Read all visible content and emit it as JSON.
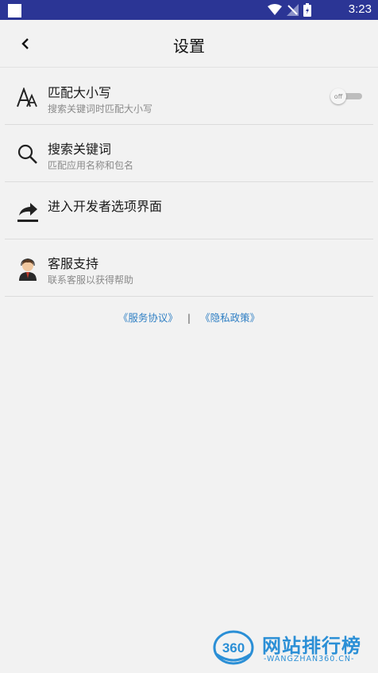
{
  "status_bar": {
    "time": "3:23",
    "icons": [
      "wifi-icon",
      "signal-off-icon",
      "battery-icon"
    ]
  },
  "header": {
    "title": "设置",
    "back_icon": "chevron-left-icon"
  },
  "settings": [
    {
      "title": "匹配大小写",
      "subtitle": "搜索关键词时匹配大小写",
      "icon": "font-size-icon",
      "toggle": {
        "label": "off",
        "on": false
      }
    },
    {
      "title": "搜索关键词",
      "subtitle": "匹配应用名称和包名",
      "icon": "search-icon"
    },
    {
      "title": "进入开发者选项界面",
      "subtitle": "",
      "icon": "share-arrow-icon"
    },
    {
      "title": "客服支持",
      "subtitle": "联系客服以获得帮助",
      "icon": "customer-service-avatar-icon"
    }
  ],
  "links": {
    "service": "《服务协议》",
    "separator": "|",
    "privacy": "《隐私政策》"
  },
  "watermark": {
    "logo_text": "360",
    "name": "网站排行榜",
    "url": "-WANGZHAN360.CN-"
  },
  "colors": {
    "status_bar": "#2b3595",
    "link": "#2f7fc4",
    "background": "#f2f2f2"
  }
}
